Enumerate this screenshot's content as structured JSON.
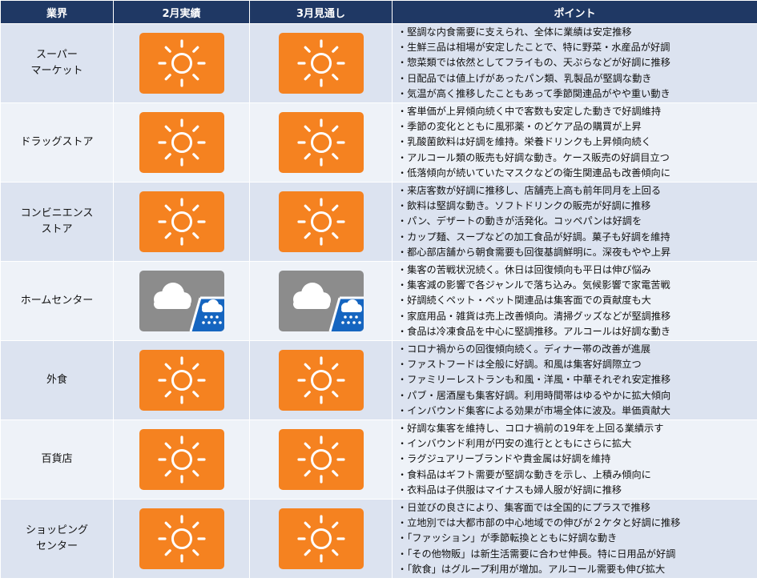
{
  "header": {
    "industry": "業界",
    "feb_actual": "2月実績",
    "mar_outlook": "3月見通し",
    "points": "ポイント"
  },
  "rows": [
    {
      "industry": "スーパー\nマーケット",
      "feb_icon": "sun-icon",
      "mar_icon": "sun-icon",
      "points": [
        "・堅調な内食需要に支えられ、全体に業績は安定推移",
        "・生鮮三品は相場が安定したことで、特に野菜・水産品が好調",
        "・惣菜類では依然としてフライもの、天ぷらなどが好調に推移",
        "・日配品では値上げがあったパン類、乳製品が堅調な動き",
        "・気温が高く推移したこともあって季節関連品がやや重い動き"
      ]
    },
    {
      "industry": "ドラッグストア",
      "feb_icon": "sun-icon",
      "mar_icon": "sun-icon",
      "points": [
        "・客単価が上昇傾向続く中で客数も安定した動きで好調維持",
        "・季節の変化とともに風邪薬・のどケア品の購買が上昇",
        "・乳酸菌飲料は好調を維持。栄養ドリンクも上昇傾向続く",
        "・アルコール類の販売も好調な動き。ケース販売の好調目立つ",
        "・低落傾向が続いていたマスクなどの衛生関連品も改善傾向に"
      ]
    },
    {
      "industry": "コンビニエンス\nストア",
      "feb_icon": "sun-icon",
      "mar_icon": "sun-icon",
      "points": [
        "・来店客数が好調に推移し、店舗売上高も前年同月を上回る",
        "・飲料は堅調な動き。ソフトドリンクの販売が好調に推移",
        "・パン、デザートの動きが活発化。コッペパンは好調を",
        "・カップ麺、スープなどの加工食品が好調。菓子も好調を維持",
        "・都心部店舗から朝食需要も回復基調鮮明に。深夜もやや上昇"
      ]
    },
    {
      "industry": "ホームセンター",
      "feb_icon": "cloud-rain-icon",
      "mar_icon": "cloud-rain-icon",
      "points": [
        "・集客の苦戦状況続く。休日は回復傾向も平日は伸び悩み",
        "・集客減の影響で各ジャンルで落ち込み。気候影響で家電苦戦",
        "・好調続くペット・ペット関連品は集客面での貢献度も大",
        "・家庭用品・雑貨は売上改善傾向。清掃グッズなどが堅調推移",
        "・食品は冷凍食品を中心に堅調推移。アルコールは好調な動き"
      ]
    },
    {
      "industry": "外食",
      "feb_icon": "sun-icon",
      "mar_icon": "sun-icon",
      "points": [
        "・コロナ禍からの回復傾向続く。ディナー帯の改善が進展",
        "・ファストフードは全般に好調。和風は集客好調際立つ",
        "・ファミリーレストランも和風・洋風・中華それぞれ安定推移",
        "・パブ・居酒屋も集客好調。利用時間帯はゆるやかに拡大傾向",
        "・インバウンド集客による効果が市場全体に波及。単価貢献大"
      ]
    },
    {
      "industry": "百貨店",
      "feb_icon": "sun-icon",
      "mar_icon": "sun-icon",
      "points": [
        "・好調な集客を維持し、コロナ禍前の19年を上回る業績示す",
        "・インバウンド利用が円安の進行とともにさらに拡大",
        "・ラグジュアリーブランドや貴金属は好調を維持",
        "・食料品はギフト需要が堅調な動きを示し、上積み傾向に",
        "・衣料品は子供服はマイナスも婦人服が好調に推移"
      ]
    },
    {
      "industry": "ショッピング\nセンター",
      "feb_icon": "sun-icon",
      "mar_icon": "sun-icon",
      "points": [
        "・日並びの良さにより、集客面では全国的にプラスで推移",
        "・立地別では大都市部の中心地域での伸びが２ケタと好調に推移",
        "・「ファッション」が季節転換とともに好調な動き",
        "・「その他物販」は新生活需要に合わせ伸長。特に日用品が好調",
        "・「飲食」はグループ利用が増加。アルコール需要も伸び拡大"
      ]
    }
  ],
  "colors": {
    "header_bg": "#1f3864",
    "row_odd": "#dce3f0",
    "row_even": "#eef2f8",
    "sun_tile": "#f58220",
    "cloud_tile": "#8c8c8c",
    "rain_panel": "#1565c0"
  }
}
